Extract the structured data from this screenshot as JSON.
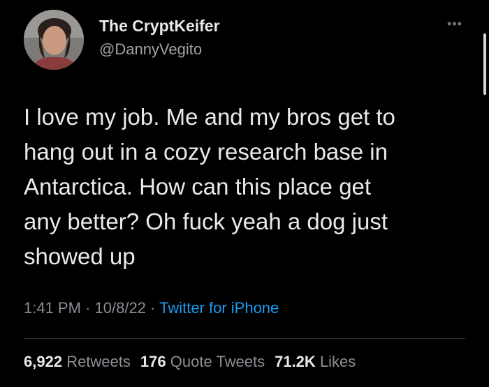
{
  "author": {
    "name": "The CryptKeifer",
    "handle": "@DannyVegito"
  },
  "icons": {
    "more": "more-horizontal-icon",
    "avatar": "user-avatar"
  },
  "tweet": {
    "text_lines": [
      "I love my job. Me and my bros get to",
      "hang out in a cozy research base in",
      "Antarctica. How can this place get",
      "any better? Oh fuck yeah a dog just",
      "showed up"
    ]
  },
  "meta": {
    "time": "1:41 PM",
    "separator": "·",
    "date": "10/8/22",
    "source": "Twitter for iPhone"
  },
  "stats": {
    "retweets_count": "6,922",
    "retweets_label": "Retweets",
    "quote_count": "176",
    "quote_label": "Quote Tweets",
    "likes_count": "71.2K",
    "likes_label": "Likes"
  },
  "colors": {
    "background": "#000000",
    "text": "#e7e9ea",
    "secondary": "#8b8f94",
    "link": "#1d9bf0"
  }
}
